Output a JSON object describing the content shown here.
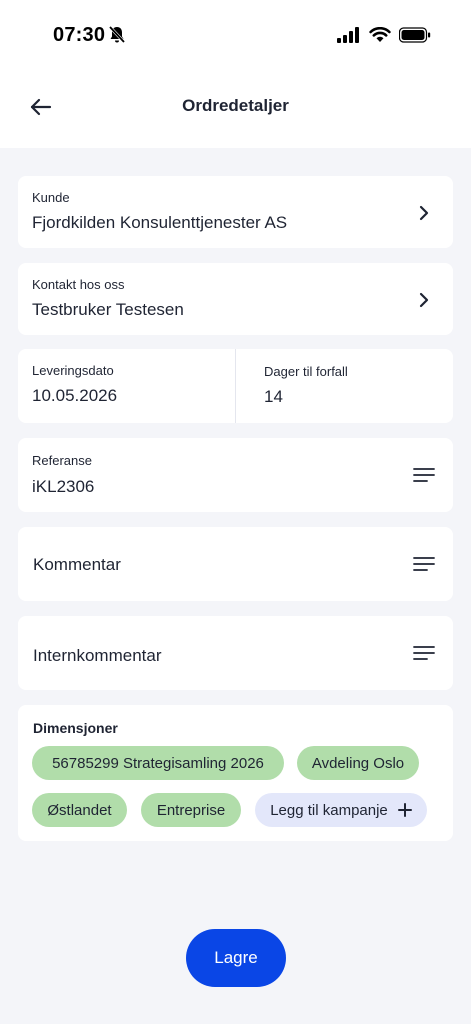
{
  "status_bar": {
    "time": "07:30"
  },
  "header": {
    "title": "Ordredetaljer"
  },
  "customer": {
    "label": "Kunde",
    "value": "Fjordkilden Konsulenttjenester AS"
  },
  "contact": {
    "label": "Kontakt hos oss",
    "value": "Testbruker Testesen"
  },
  "delivery": {
    "label": "Leveringsdato",
    "value": "10.05.2026"
  },
  "due_days": {
    "label": "Dager til forfall",
    "value": "14"
  },
  "reference": {
    "label": "Referanse",
    "value": "iKL2306"
  },
  "comment": {
    "label": "Kommentar"
  },
  "internal_comment": {
    "label": "Internkommentar"
  },
  "dimensions": {
    "title": "Dimensjoner",
    "chips": [
      "56785299 Strategisamling 2026",
      "Avdeling Oslo",
      "Østlandet",
      "Entreprise"
    ],
    "add_label": "Legg til kampanje"
  },
  "actions": {
    "save_label": "Lagre"
  },
  "colors": {
    "accent": "#0a46e6",
    "chip": "#b1ddaa",
    "add_chip": "#e3e7fa",
    "background": "#f4f5f9"
  }
}
